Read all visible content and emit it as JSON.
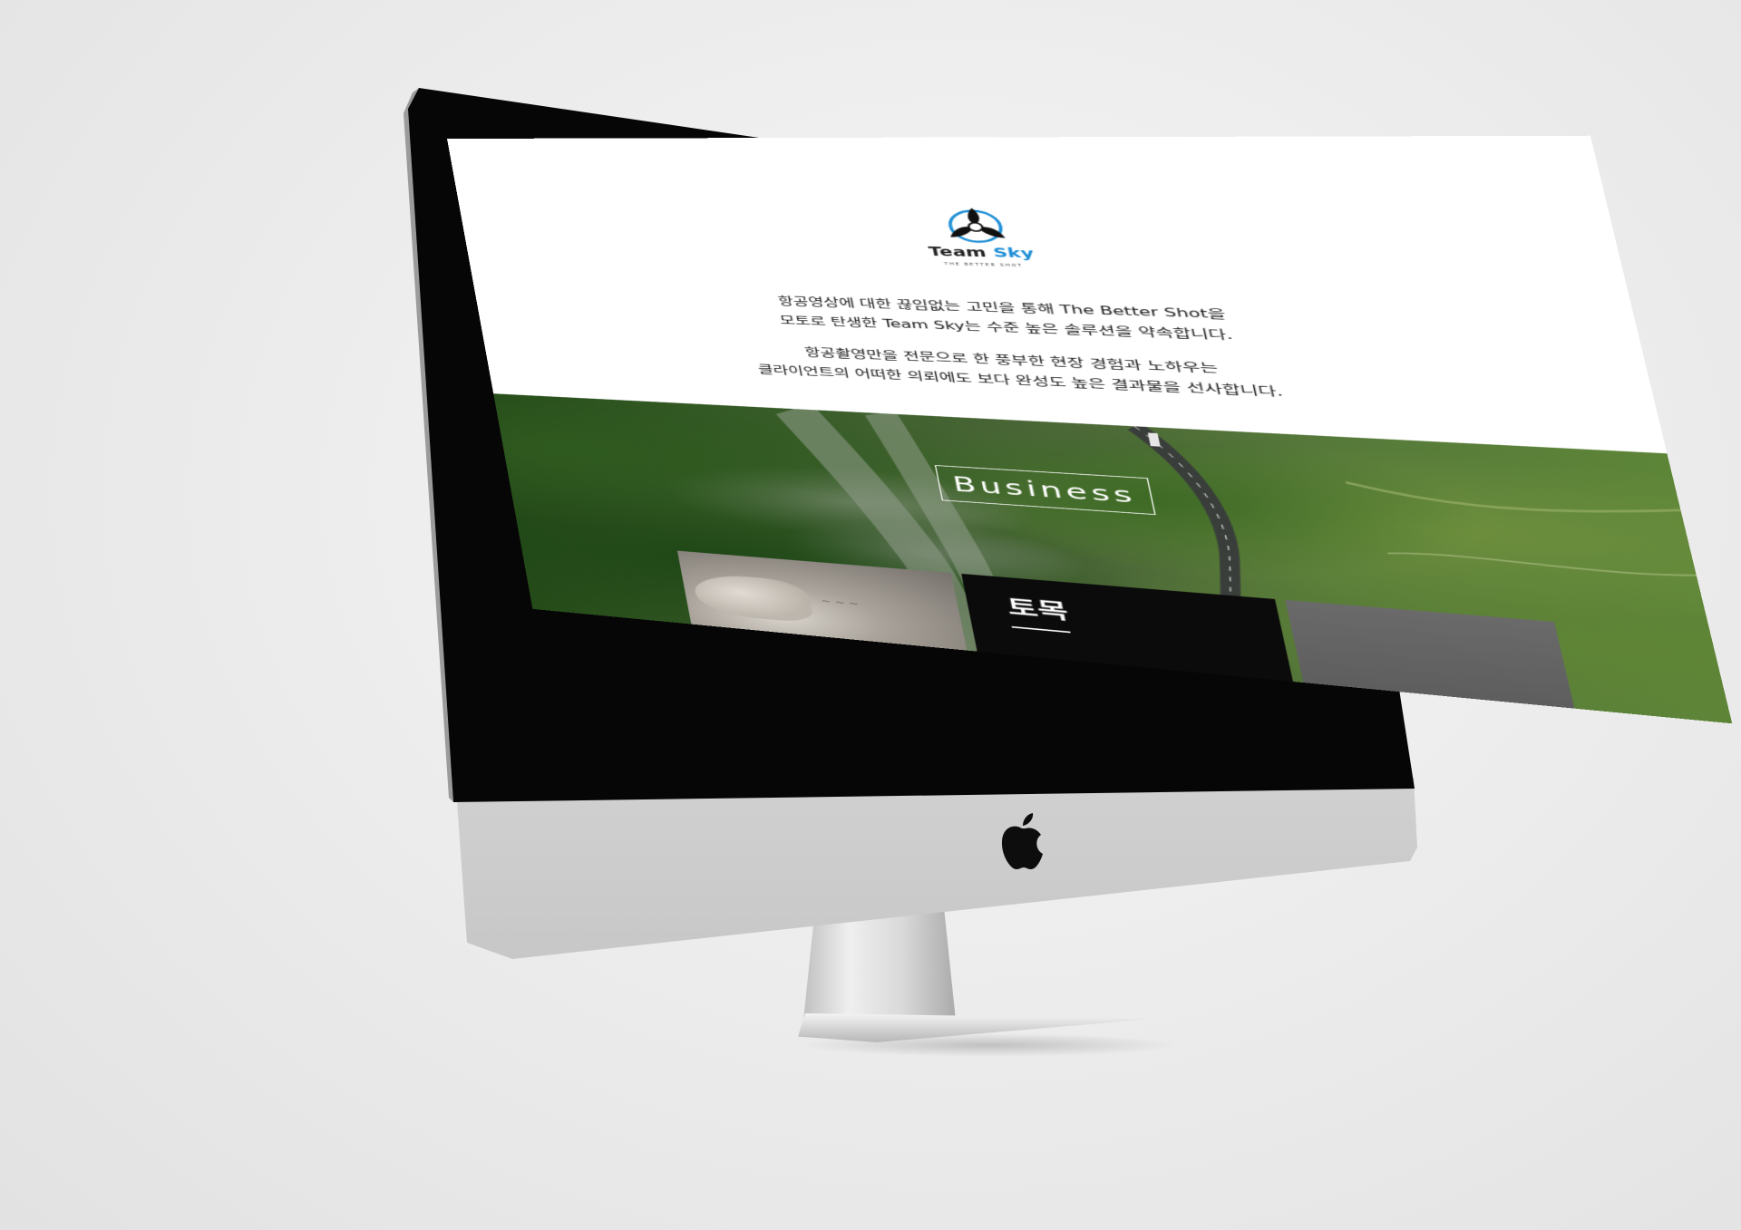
{
  "brand": {
    "name_part1": "Team",
    "name_part2": "Sky",
    "tagline": "THE BETTER SHOT"
  },
  "intro": {
    "paragraph1_line1": "항공영상에 대한 끊임없는 고민을 통해 The Better Shot을",
    "paragraph1_line2": "모토로 탄생한 Team Sky는 수준 높은 솔루션을 약속합니다.",
    "paragraph2_line1": "항공촬영만을 전문으로 한 풍부한 현장 경험과 노하우는",
    "paragraph2_line2": "클라이언트의 어떠한 의뢰에도 보다  완성도 높은 결과물을 선사합니다."
  },
  "hero": {
    "section_title": "Business"
  },
  "cards": [
    {
      "title": ""
    },
    {
      "title": "토목"
    },
    {
      "title": ""
    }
  ],
  "colors": {
    "brand_blue": "#1e8fd6",
    "card_dark": "#0b0b0b",
    "bezel": "#060606"
  }
}
